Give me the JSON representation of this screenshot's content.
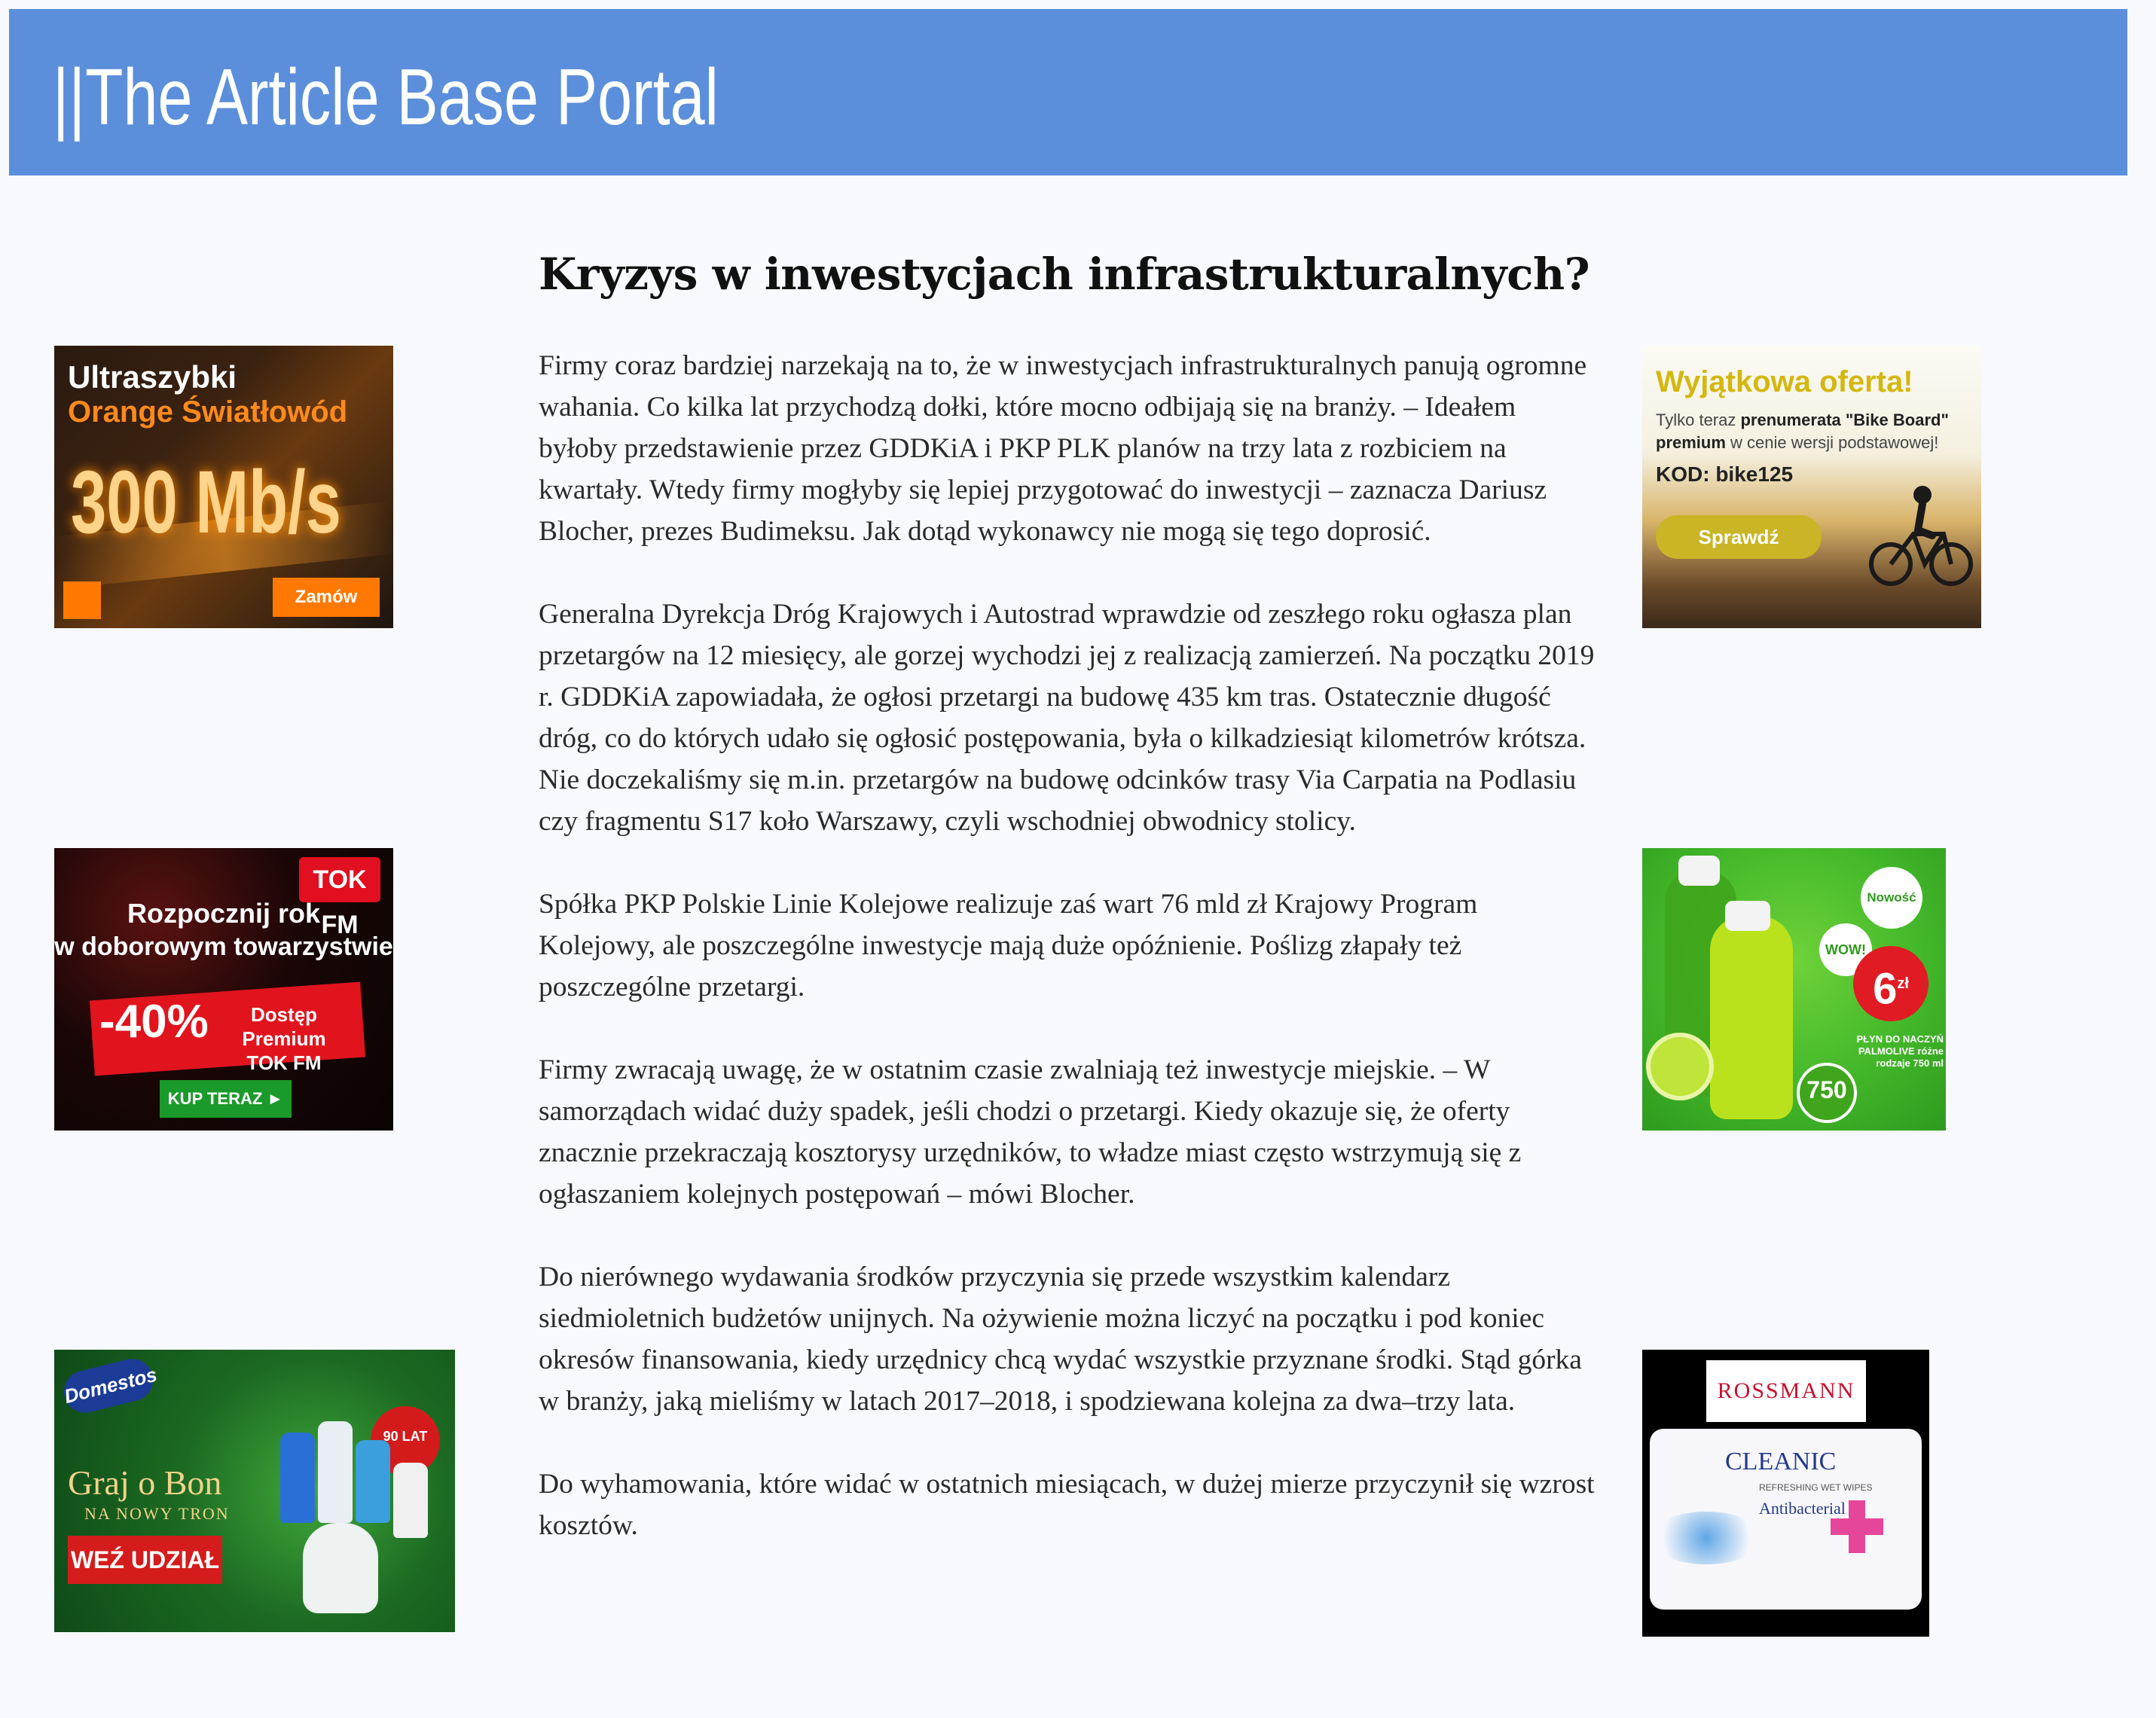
{
  "header": {
    "title": "||The Article Base Portal",
    "background": "#5b8fdb"
  },
  "article": {
    "title": "Kryzys w inwestycjach infrastrukturalnych?",
    "paragraphs": [
      "Firmy coraz bardziej narzekają na to, że w inwestycjach infrastrukturalnych panują ogromne wahania. Co kilka lat przychodzą dołki, które mocno odbijają się na branży. – Ideałem byłoby przedstawienie przez GDDKiA i PKP PLK planów na trzy lata z rozbiciem na kwartały. Wtedy firmy mogłyby się lepiej przygotować do inwestycji – zaznacza Dariusz Blocher, prezes Budimeksu. Jak dotąd wykonawcy nie mogą się tego doprosić.",
      "Generalna Dyrekcja Dróg Krajowych i Autostrad wprawdzie od zeszłego roku ogłasza plan przetargów na 12 miesięcy, ale gorzej wychodzi jej z realizacją zamierzeń. Na początku 2019 r. GDDKiA zapowiadała, że ogłosi przetargi na budowę 435 km tras. Ostatecznie długość dróg, co do których udało się ogłosić postępowania, była o kilkadziesiąt kilometrów krótsza. Nie doczekaliśmy się m.in. przetargów na budowę odcinków trasy Via Carpatia na Podlasiu czy fragmentu S17 koło Warszawy, czyli wschodniej obwodnicy stolicy.",
      "Spółka PKP Polskie Linie Kolejowe realizuje zaś wart 76 mld zł Krajowy Program Kolejowy, ale poszczególne inwestycje mają duże opóźnienie. Poślizg złapały też poszczególne przetargi.",
      "Firmy zwracają uwagę, że w ostatnim czasie zwalniają też inwestycje miejskie. – W samorządach widać duży spadek, jeśli chodzi o przetargi. Kiedy okazuje się, że oferty znacznie przekraczają kosztorysy urzędników, to władze miast często wstrzymują się z ogłaszaniem kolejnych postępowań – mówi Blocher.",
      "Do nierównego wydawania środków przyczynia się przede wszystkim kalendarz siedmioletnich budżetów unijnych. Na ożywienie można liczyć na początku i pod koniec okresów finansowania, kiedy urzędnicy chcą wydać wszystkie przyznane środki. Stąd górka w branży, jaką mieliśmy w latach 2017–2018, i spodziewana kolejna za dwa–trzy lata.",
      "Do wyhamowania, które widać w ostatnich miesiącach, w dużej mierze przyczynił się wzrost kosztów."
    ]
  },
  "ads": {
    "orange": {
      "line1": "Ultraszybki",
      "line2": "Orange Światłowód",
      "speed": "300 Mb/s",
      "cta": "Zamów",
      "accent": "#ff7900"
    },
    "tokfm": {
      "logo": "TOK FM",
      "line1": "Rozpocznij rok",
      "line2": "w doborowym towarzystwie",
      "discount": "-40%",
      "offer": "Dostęp Premium TOK FM",
      "cta": "KUP TERAZ ►",
      "accent": "#e10f1f"
    },
    "domestos": {
      "logo": "Domestos",
      "headline": "Graj o Bon",
      "subline": "NA NOWY TRON",
      "badge": "90 LAT",
      "cta": "WEŹ UDZIAŁ",
      "accent": "#d51c1c"
    },
    "bike": {
      "headline": "Wyjątkowa oferta!",
      "text_prefix": "Tylko teraz ",
      "text_bold1": "prenumerata \"Bike Board\" premium",
      "text_suffix": " w cenie wersji podstawowej!",
      "code": "KOD: bike125",
      "cta": "Sprawdź",
      "accent": "#c9b525"
    },
    "palmolive": {
      "badge_new": "Nowość",
      "badge_wow": "WOW!",
      "price": "6",
      "price_unit": "zł",
      "description": "PŁYN DO NACZYŃ PALMOLIVE różne rodzaje 750 ml",
      "volume": "750",
      "accent": "#e01b24"
    },
    "rossmann": {
      "logo": "ROSSMANN",
      "brand": "CLEANIC",
      "subtitle": "REFRESHING WET WIPES",
      "variant": "Antibacterial",
      "accent": "#c8102e"
    }
  }
}
